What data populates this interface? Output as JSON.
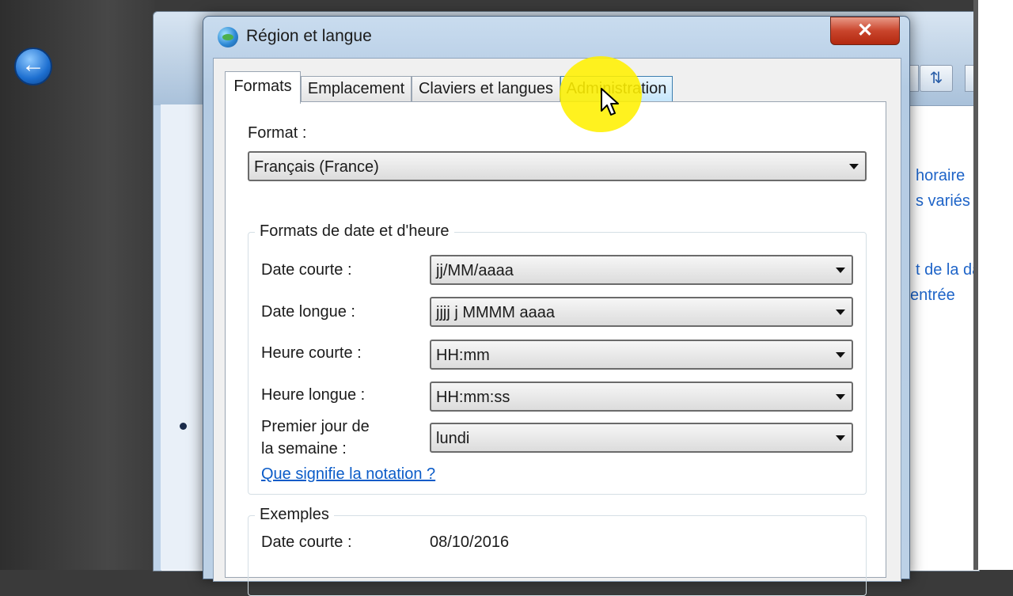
{
  "background_window": {
    "side_links": [
      "horaire",
      "s variés",
      "t de la da",
      "entrée"
    ]
  },
  "dialog": {
    "title": "Région et langue",
    "close_label": "✕"
  },
  "tabs": [
    {
      "label": "Formats",
      "active": true
    },
    {
      "label": "Emplacement",
      "active": false
    },
    {
      "label": "Claviers et langues",
      "active": false
    },
    {
      "label": "Administration",
      "active": false,
      "hovered": true
    }
  ],
  "format": {
    "label": "Format :",
    "value": "Français (France)"
  },
  "date_time_group": {
    "title": "Formats de date et d'heure",
    "rows": [
      {
        "label": "Date courte :",
        "value": "jj/MM/aaaa"
      },
      {
        "label": "Date longue :",
        "value": "jjjj j MMMM aaaa"
      },
      {
        "label": "Heure courte :",
        "value": "HH:mm"
      },
      {
        "label": "Heure longue :",
        "value": "HH:mm:ss"
      },
      {
        "label_line1": "Premier jour de",
        "label_line2": "la semaine :",
        "value": "lundi"
      }
    ],
    "link": "Que signifie la notation ?"
  },
  "examples_group": {
    "title": "Exemples",
    "rows": [
      {
        "label": "Date courte :",
        "value": "08/10/2016"
      }
    ]
  },
  "colors": {
    "link": "#0b5cc8",
    "highlight": "#fff000",
    "close_button": "#c9452c"
  }
}
